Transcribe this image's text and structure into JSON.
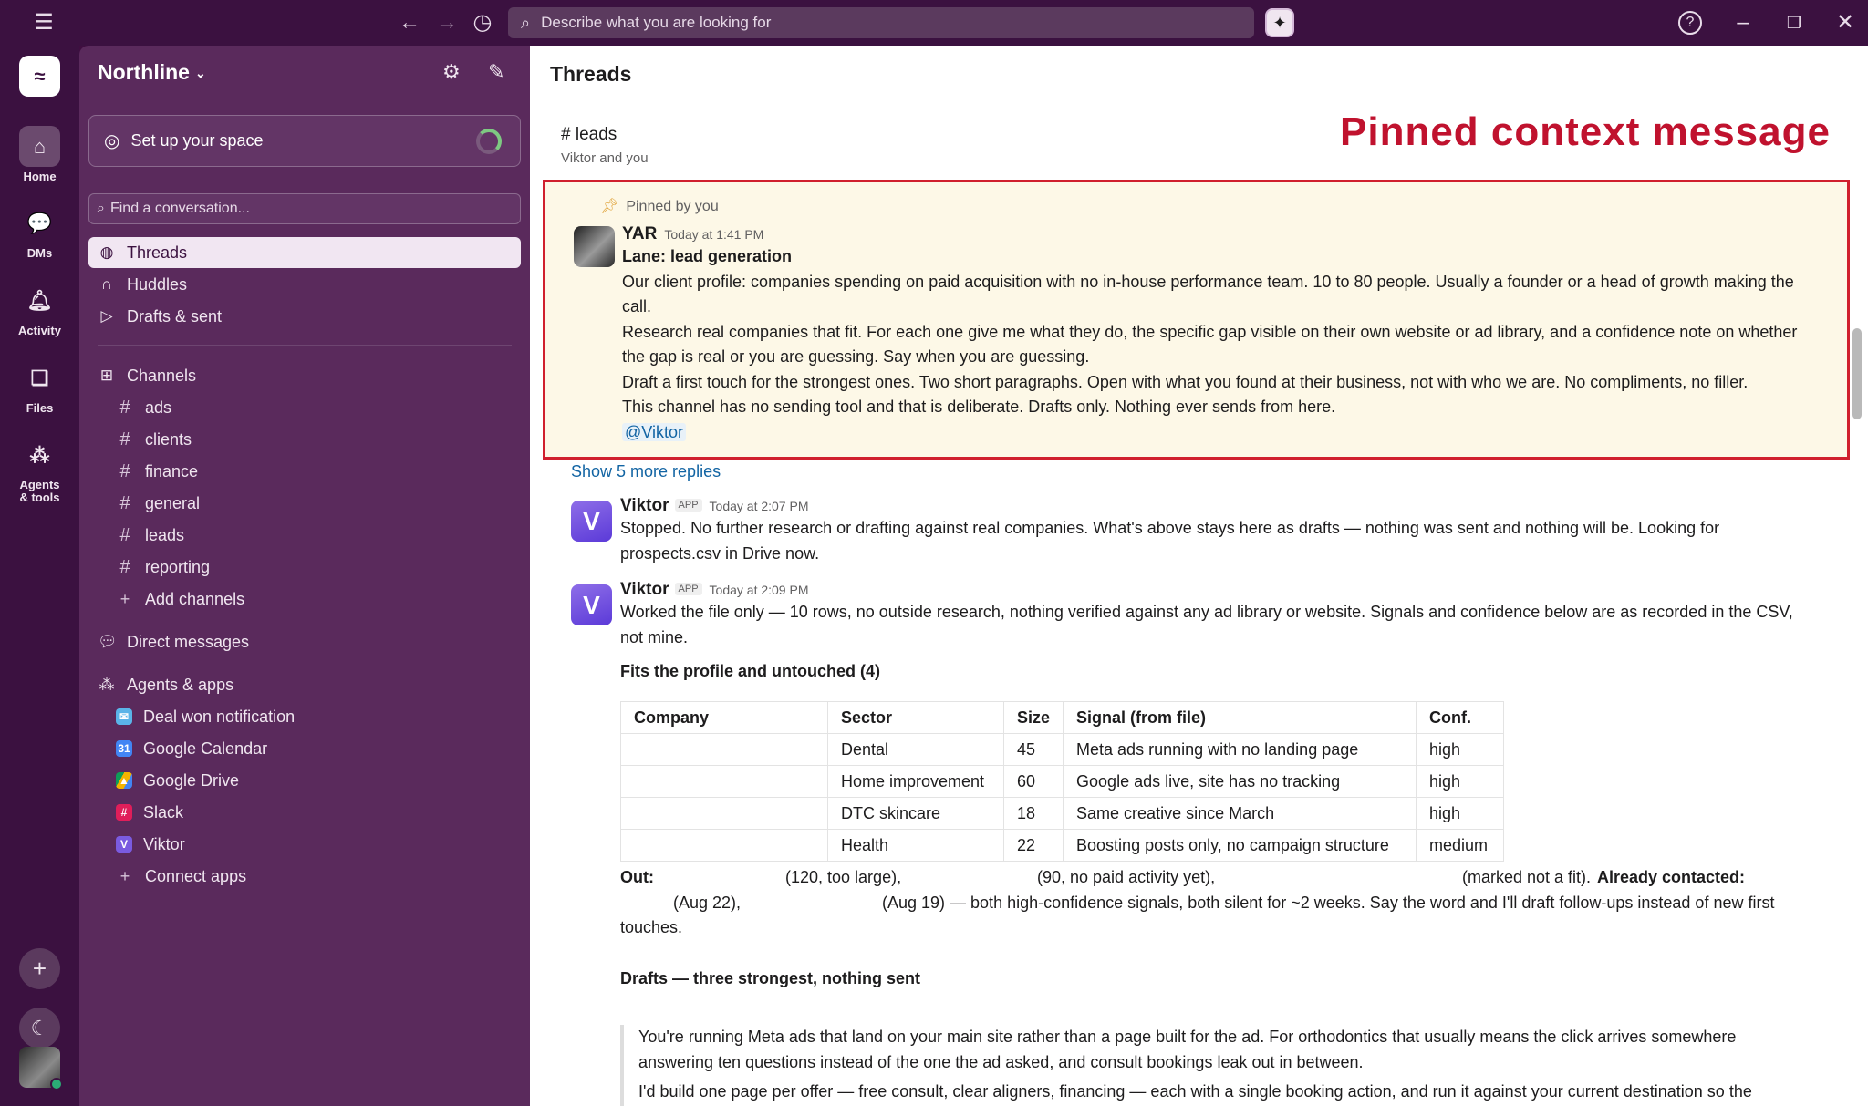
{
  "topbar": {
    "search_placeholder": "Describe what you are looking for"
  },
  "rail": {
    "items": [
      {
        "label": "Home"
      },
      {
        "label": "DMs"
      },
      {
        "label": "Activity"
      },
      {
        "label": "Files"
      },
      {
        "label": "Agents\n& tools"
      }
    ]
  },
  "sidebar": {
    "workspace_name": "Northline",
    "setup_label": "Set up your space",
    "find_placeholder": "Find a conversation...",
    "nav": [
      {
        "label": "Threads"
      },
      {
        "label": "Huddles"
      },
      {
        "label": "Drafts & sent"
      }
    ],
    "channels_header": "Channels",
    "channels": [
      "ads",
      "clients",
      "finance",
      "general",
      "leads",
      "reporting"
    ],
    "add_channels": "Add channels",
    "direct_messages": "Direct messages",
    "agents_header": "Agents & apps",
    "apps": [
      "Deal won notification",
      "Google Calendar",
      "Google Drive",
      "Slack",
      "Viktor"
    ],
    "connect_apps": "Connect apps"
  },
  "main": {
    "title": "Threads",
    "channel_name": "leads",
    "channel_members": "Viktor and you",
    "annotation": "Pinned context message",
    "pinned": {
      "label": "Pinned by you",
      "author": "YAR",
      "time": "Today at 1:41 PM",
      "lines": [
        "Lane: lead generation",
        "Our client profile: companies spending on paid acquisition with no in-house performance team. 10 to 80 people. Usually a founder or a head of growth making the",
        "call.",
        "Research real companies that fit. For each one give me what they do, the specific gap visible on their own website or ad library, and a confidence note on whether",
        "the gap is real or you are guessing. Say when you are guessing.",
        "Draft a first touch for the strongest ones. Two short paragraphs. Open with what you found at their business, not with who we are. No compliments, no filler.",
        "This channel has no sending tool and that is deliberate. Drafts only. Nothing ever sends from here."
      ],
      "mention": "@Viktor"
    },
    "show_replies": "Show 5 more replies",
    "reply1": {
      "author": "Viktor",
      "badge": "APP",
      "time": "Today at 2:07 PM",
      "line1": "Stopped. No further research or drafting against real companies. What's above stays here as drafts — nothing was sent and nothing will be. Looking for",
      "line2": "prospects.csv in Drive now."
    },
    "reply2": {
      "author": "Viktor",
      "badge": "APP",
      "time": "Today at 2:09 PM",
      "line1": "Worked the file only — 10 rows, no outside research, nothing verified against any ad library or website. Signals and confidence below are as recorded in the CSV,",
      "line2": "not mine.",
      "fits_header": "Fits the profile and untouched (4)",
      "table": {
        "headers": [
          "Company",
          "Sector",
          "Size",
          "Signal (from file)",
          "Conf."
        ],
        "rows": [
          [
            "",
            "Dental",
            "45",
            "Meta ads running with no landing page",
            "high"
          ],
          [
            "",
            "Home improvement",
            "60",
            "Google ads live, site has no tracking",
            "high"
          ],
          [
            "",
            "DTC skincare",
            "18",
            "Same creative since March",
            "high"
          ],
          [
            "",
            "Health",
            "22",
            "Boosting posts only, no campaign structure",
            "medium"
          ]
        ]
      },
      "out_label": "Out:",
      "out_a": "(120, too large),",
      "out_b": "(90, no paid activity yet),",
      "out_c": "(marked not a fit).",
      "already_label": "Already contacted:",
      "contacted_a": "(Aug 22),",
      "contacted_b": "(Aug 19) — both high-confidence signals, both silent for ~2 weeks. Say the word and I'll draft follow-ups instead of new first",
      "contacted_c": "touches.",
      "drafts_header": "Drafts — three strongest, nothing sent",
      "draft_lines": [
        "You're running Meta ads that land on your main site rather than a page built for the ad. For orthodontics that usually means the click arrives somewhere",
        "answering ten questions instead of the one the ad asked, and consult bookings leak out in between.",
        "I'd build one page per offer — free consult, clear aligners, financing — each with a single booking action, and run it against your current destination so the"
      ]
    }
  }
}
